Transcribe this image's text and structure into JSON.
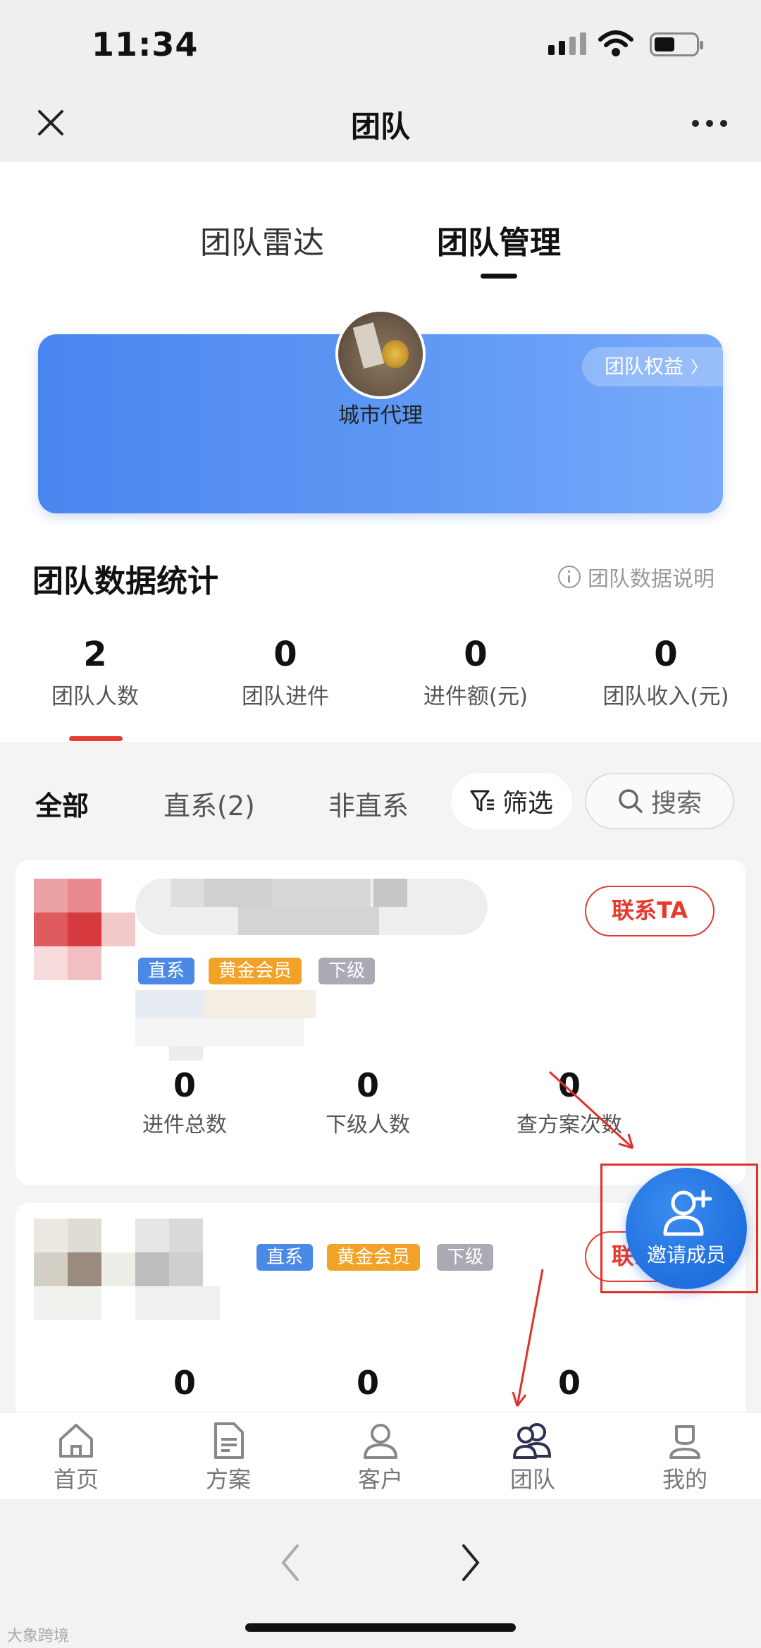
{
  "status": {
    "time": "11:34"
  },
  "nav": {
    "title": "团队"
  },
  "top_tabs": [
    "团队雷达",
    "团队管理"
  ],
  "profile": {
    "role": "城市代理",
    "rights_label": "团队权益"
  },
  "stats": {
    "title": "团队数据统计",
    "note": "团队数据说明",
    "items": [
      {
        "value": "2",
        "label": "团队人数"
      },
      {
        "value": "0",
        "label": "团队进件"
      },
      {
        "value": "0",
        "label": "进件额(元)"
      },
      {
        "value": "0",
        "label": "团队收入(元)"
      }
    ]
  },
  "filters": {
    "tabs": [
      "全部",
      "直系(2)",
      "非直系"
    ],
    "filter_label": "筛选",
    "search_label": "搜索"
  },
  "members": [
    {
      "contact_label": "联系TA",
      "tags": [
        "直系",
        "黄金会员",
        "下级"
      ],
      "stats": [
        {
          "value": "0",
          "label": "进件总数"
        },
        {
          "value": "0",
          "label": "下级人数"
        },
        {
          "value": "0",
          "label": "查方案次数"
        }
      ]
    },
    {
      "contact_label": "联系TA",
      "tags": [
        "直系",
        "黄金会员",
        "下级"
      ],
      "stats": [
        {
          "value": "0"
        },
        {
          "value": "0"
        },
        {
          "value": "0"
        }
      ]
    }
  ],
  "invite": {
    "label": "邀请成员"
  },
  "tabbar": [
    {
      "label": "首页",
      "icon": "home-icon"
    },
    {
      "label": "方案",
      "icon": "document-icon"
    },
    {
      "label": "客户",
      "icon": "person-icon"
    },
    {
      "label": "团队",
      "icon": "team-icon"
    },
    {
      "label": "我的",
      "icon": "profile-icon"
    }
  ],
  "watermark": "大象跨境",
  "colors": {
    "accent_red": "#e63a30",
    "blue": "#4a86ef",
    "gold": "#f2a227"
  }
}
